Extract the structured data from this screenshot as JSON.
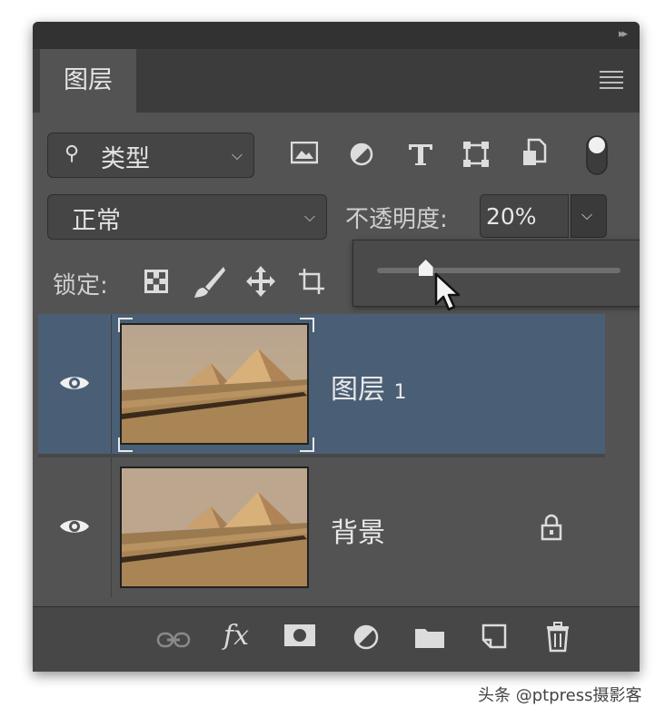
{
  "panel": {
    "tab_label": "图层",
    "collapse_glyph": "▸▸",
    "menu_icon": "hamburger-menu-icon"
  },
  "filter": {
    "label": "类型",
    "icons": [
      "image-filter-icon",
      "adjustment-filter-icon",
      "type-filter-icon",
      "shape-filter-icon",
      "smart-object-filter-icon",
      "filter-toggle-icon"
    ]
  },
  "blend": {
    "mode": "正常",
    "opacity_label": "不透明度:",
    "opacity_value": "20%"
  },
  "opacity_slider": {
    "value_fraction": 0.2
  },
  "lock": {
    "label": "锁定:",
    "icons": [
      "lock-transparency-icon",
      "lock-image-pixels-icon",
      "lock-position-icon",
      "lock-artboard-icon"
    ]
  },
  "layers": [
    {
      "name": "图层",
      "number": "1",
      "selected": true,
      "visible": true,
      "locked": false
    },
    {
      "name": "背景",
      "number": "",
      "selected": false,
      "visible": true,
      "locked": true
    }
  ],
  "colors": {
    "panel_bg": "#535353",
    "selected_row": "#4a5f75",
    "header_bg": "#323232"
  },
  "bottom_bar": {
    "icons": [
      "link-layers-icon",
      "fx-icon",
      "layer-mask-icon",
      "adjustment-layer-icon",
      "group-folder-icon",
      "new-layer-icon",
      "trash-icon"
    ],
    "fx_text": "fx"
  },
  "watermark": "头条 @ptpress摄影客"
}
